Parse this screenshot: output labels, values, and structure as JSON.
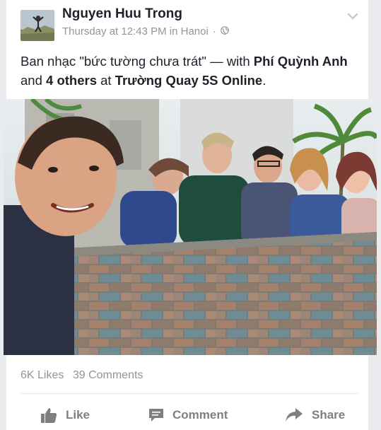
{
  "post": {
    "author": "Nguyen Huu Trong",
    "time": "Thursday at 12:43 PM",
    "location_prefix": "in",
    "location": "Hanoi",
    "separator": "·",
    "audience_icon": "globe-icon",
    "text": {
      "part1": "Ban nhạc \"bức tường chưa trát\" — with ",
      "tag1": "Phí Quỳnh Anh",
      "part2": " and ",
      "tag2": "4 others",
      "part3": " at ",
      "place": "Trường Quay 5S Online",
      "part4": "."
    }
  },
  "stats": {
    "likes": "6K Likes",
    "comments": "39 Comments"
  },
  "actions": {
    "like": "Like",
    "comment": "Comment",
    "share": "Share"
  },
  "colors": {
    "text": "#1d2129",
    "meta": "#90949c",
    "action": "#7f7f7f"
  }
}
